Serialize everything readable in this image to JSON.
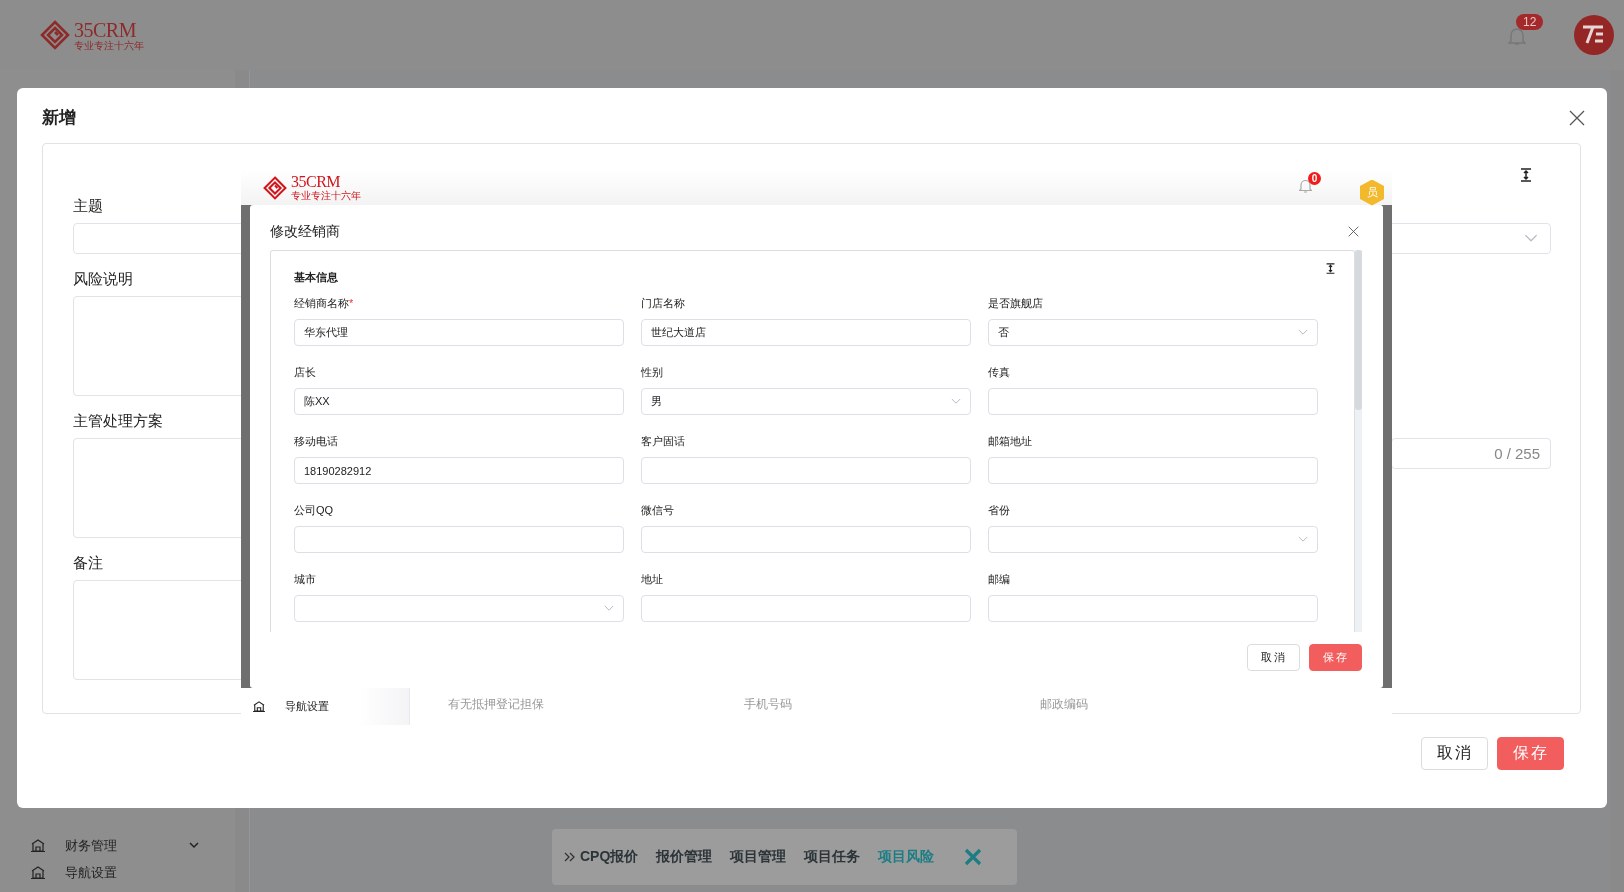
{
  "app": {
    "logo": {
      "name": "35CRM",
      "tagline": "专业专注十六年"
    },
    "notification_count": "12",
    "sidebar": {
      "items": [
        {
          "label": "财务管理",
          "kind": "group"
        },
        {
          "label": "导航设置",
          "kind": "link"
        }
      ]
    },
    "quick_tabs": {
      "items": [
        {
          "label": "CPQ报价",
          "selected": false
        },
        {
          "label": "报价管理",
          "selected": false
        },
        {
          "label": "项目管理",
          "selected": false
        },
        {
          "label": "项目任务",
          "selected": false
        },
        {
          "label": "项目风险",
          "selected": true
        }
      ]
    }
  },
  "add_modal": {
    "title": "新增",
    "fields": [
      {
        "label": "主题",
        "kind": "select"
      },
      {
        "label": "风险说明",
        "kind": "textarea"
      },
      {
        "label": "主管处理方案",
        "kind": "textarea",
        "counter": "0 / 255"
      },
      {
        "label": "备注",
        "kind": "textarea"
      }
    ],
    "buttons": [
      {
        "label": "取消",
        "kind": "secondary"
      },
      {
        "label": "保存",
        "kind": "primary"
      }
    ]
  },
  "embedded_page": {
    "logo": {
      "name": "35CRM",
      "tagline": "专业专注十六年"
    },
    "notification_count": "0",
    "user_badge": "员",
    "sidebar_item": "导航设置",
    "columns": [
      "有无抵押登记担保",
      "手机号码",
      "邮政编码"
    ]
  },
  "dealer_dialog": {
    "title": "修改经销商",
    "section": "基本信息",
    "fields": [
      {
        "label": "经销商名称",
        "required_mark": "*",
        "kind": "text",
        "value": "华东代理"
      },
      {
        "label": "门店名称",
        "kind": "text",
        "value": "世纪大道店"
      },
      {
        "label": "是否旗舰店",
        "kind": "select",
        "value": "否"
      },
      {
        "label": "店长",
        "kind": "text",
        "value": "陈XX"
      },
      {
        "label": "性别",
        "kind": "select",
        "value": "男"
      },
      {
        "label": "传真",
        "kind": "text"
      },
      {
        "label": "移动电话",
        "kind": "text",
        "value": "18190282912"
      },
      {
        "label": "客户固话",
        "kind": "text"
      },
      {
        "label": "邮箱地址",
        "kind": "text"
      },
      {
        "label": "公司QQ",
        "kind": "text"
      },
      {
        "label": "微信号",
        "kind": "text"
      },
      {
        "label": "省份",
        "kind": "select"
      },
      {
        "label": "城市",
        "kind": "select"
      },
      {
        "label": "地址",
        "kind": "text"
      },
      {
        "label": "邮编",
        "kind": "text"
      }
    ],
    "buttons": [
      {
        "label": "取消",
        "kind": "secondary"
      },
      {
        "label": "保存",
        "kind": "primary"
      }
    ]
  }
}
